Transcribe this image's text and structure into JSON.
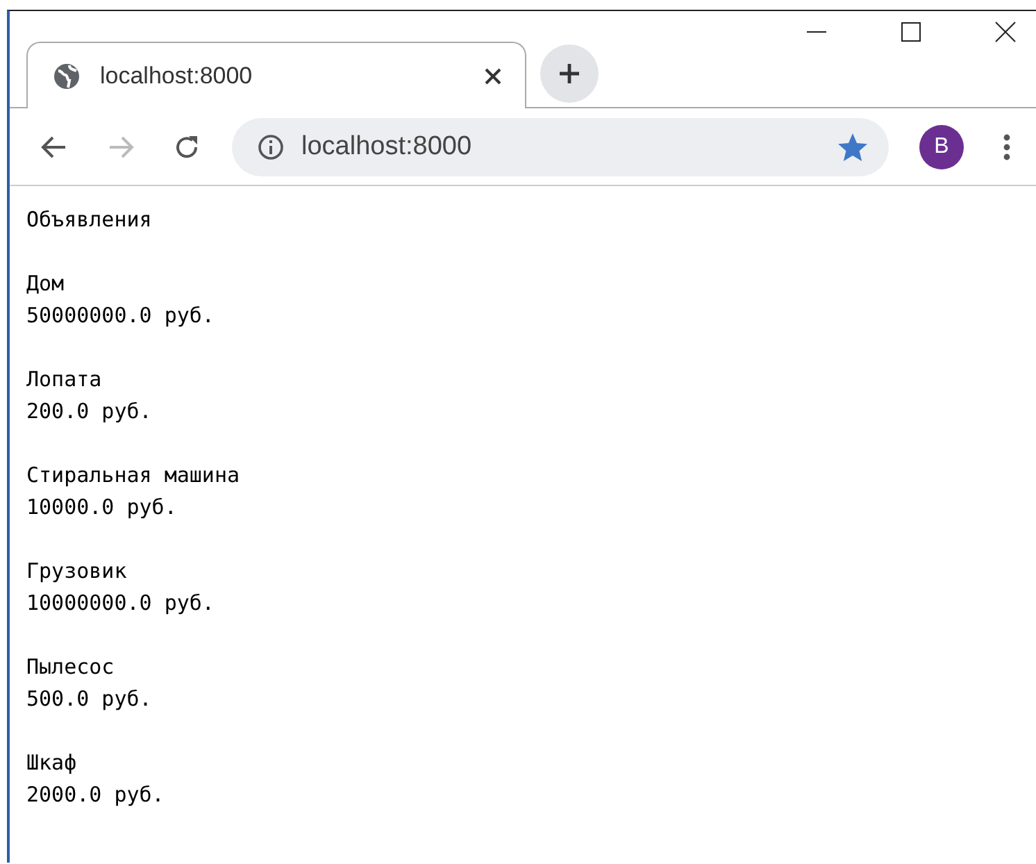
{
  "tab": {
    "title": "localhost:8000",
    "selected": true
  },
  "address_bar": {
    "value": "localhost:8000",
    "bookmarked": true
  },
  "profile": {
    "initial": "B"
  },
  "page": {
    "heading": "Объявления",
    "listings": [
      {
        "name": "Дом",
        "price": "50000000.0 руб."
      },
      {
        "name": "Лопата",
        "price": "200.0 руб."
      },
      {
        "name": "Стиральная машина",
        "price": "10000.0 руб."
      },
      {
        "name": "Грузовик",
        "price": "10000000.0 руб."
      },
      {
        "name": "Пылесос",
        "price": "500.0 руб."
      },
      {
        "name": "Шкаф",
        "price": "2000.0 руб."
      }
    ]
  }
}
